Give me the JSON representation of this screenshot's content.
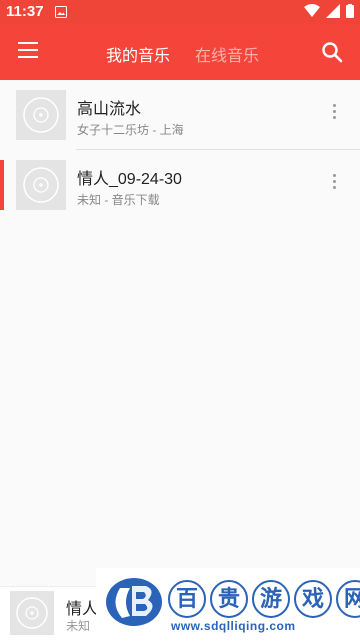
{
  "statusbar": {
    "time": "11:37"
  },
  "toolbar": {
    "tabs": [
      {
        "label": "我的音乐",
        "active": true
      },
      {
        "label": "在线音乐",
        "active": false
      }
    ]
  },
  "songs": [
    {
      "title": "高山流水",
      "subtitle": "女子十二乐坊 - 上海",
      "playing": false
    },
    {
      "title": "情人_09-24-30",
      "subtitle": "未知 - 音乐下载",
      "playing": true
    }
  ],
  "player": {
    "title": "情人",
    "subtitle": "未知"
  },
  "watermark": {
    "chars": [
      "百",
      "贵",
      "游",
      "戏",
      "网"
    ],
    "url": "www.sdqlliqing.com"
  },
  "colors": {
    "accent": "#f5453a",
    "watermark": "#2b63b8"
  }
}
